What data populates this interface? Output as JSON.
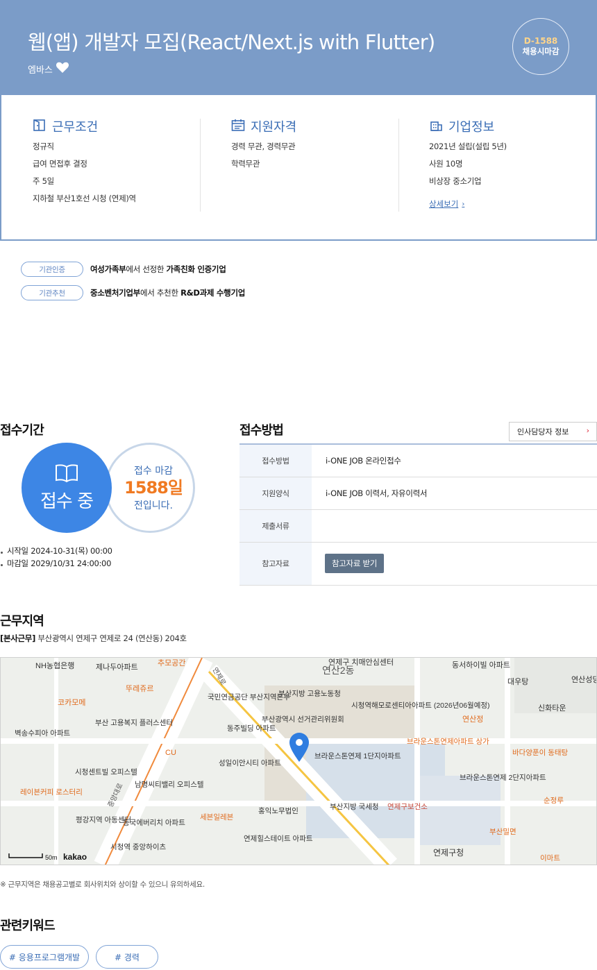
{
  "header": {
    "title": "웹(앱) 개발자 모집(React/Next.js with Flutter)",
    "company": "엠바스",
    "dday": "D-1588",
    "deadline_label": "채용시마감"
  },
  "info": {
    "work": {
      "title": "근무조건",
      "items": [
        "정규직",
        "급여 면접후 결정",
        "주 5일",
        "지하철 부산1호선 시청 (연제)역"
      ]
    },
    "qualification": {
      "title": "지원자격",
      "items": [
        "경력 무관, 경력무관",
        "학력무관"
      ]
    },
    "company": {
      "title": "기업정보",
      "items": [
        "2021년 설립(설립 5년)",
        "사원 10명",
        "비상장 중소기업"
      ],
      "detail_link": "상세보기"
    }
  },
  "certifications": [
    {
      "pill": "기관인증",
      "org": "여성가족부",
      "mid": "에서 선정한 ",
      "name": "가족친화 인증기업"
    },
    {
      "pill": "기관추천",
      "org": "중소벤처기업부",
      "mid": "에서 추천한 ",
      "name": "R&D과제 수행기업"
    }
  ],
  "period": {
    "title": "접수기간",
    "status": "접수 중",
    "deadline_top": "접수 마감",
    "deadline_days": "1588일",
    "deadline_bottom": "전입니다.",
    "start": "시작일 2024-10-31(목) 00:00",
    "end": "마감일 2029/10/31 24:00:00"
  },
  "method": {
    "title": "접수방법",
    "hr_button": "인사담당자 정보",
    "rows": [
      {
        "label": "접수방법",
        "value": "i-ONE JOB 온라인접수"
      },
      {
        "label": "지원양식",
        "value": "i-ONE JOB 이력서, 자유이력서"
      },
      {
        "label": "제출서류",
        "value": ""
      },
      {
        "label": "참고자료",
        "value": ""
      }
    ],
    "download_button": "참고자료 받기"
  },
  "location": {
    "title": "근무지역",
    "tag": "[본사근무]",
    "address": "부산광역시 연제구 연제로 24 (연산동) 204호",
    "note": "※ 근무지역은 채용공고별로 회사위치와 상이할 수 있으니 유의하세요.",
    "scale": "50m",
    "map_brand": "kakao",
    "labels": [
      "NH농협은행",
      "제나두아파트",
      "추모공간",
      "연제구 치매안심센터",
      "연산2동",
      "동서하이빌 아파트",
      "대우탕",
      "연산성당",
      "코카모메",
      "뚜레쥬르",
      "국민연금공단 부산지역본부",
      "부산지방 고용노동청",
      "시청역해모로센티아아파트 (2026년06월예정)",
      "신화타운",
      "연산정",
      "부산 고용복지 플러스센터",
      "벽송수피아 아파트",
      "동주빌딩 아파트",
      "부산광역시 선거관리위원회",
      "브라운스톤연제아파트 상가",
      "바다양푼이 동태탕",
      "CU",
      "성일이안시티 아파트",
      "브라운스톤연제 1단지아파트",
      "시청센트빌 오피스텔",
      "남명씨티밸리 오피스텔",
      "브라운스톤연제 2단지아파트",
      "레이븐커피 로스터리",
      "순정루",
      "홍익노무법인",
      "부산지방 국세청",
      "연제구보건소",
      "평강지역 아동센터",
      "동국에버리치 아파트",
      "세븐일레븐",
      "부산밀면",
      "연제힐스테이트 아파트",
      "연제구청",
      "시청역 중앙하이츠",
      "이마트",
      "중앙대로",
      "연제로"
    ]
  },
  "keywords": {
    "title": "관련키워드",
    "items": [
      "# 응용프로그램개발",
      "# 경력"
    ]
  },
  "colors": {
    "header_bg": "#7b9cc8",
    "accent_blue": "#3d86e5",
    "deadline_orange": "#f07a22",
    "link_blue": "#3a6db5"
  }
}
